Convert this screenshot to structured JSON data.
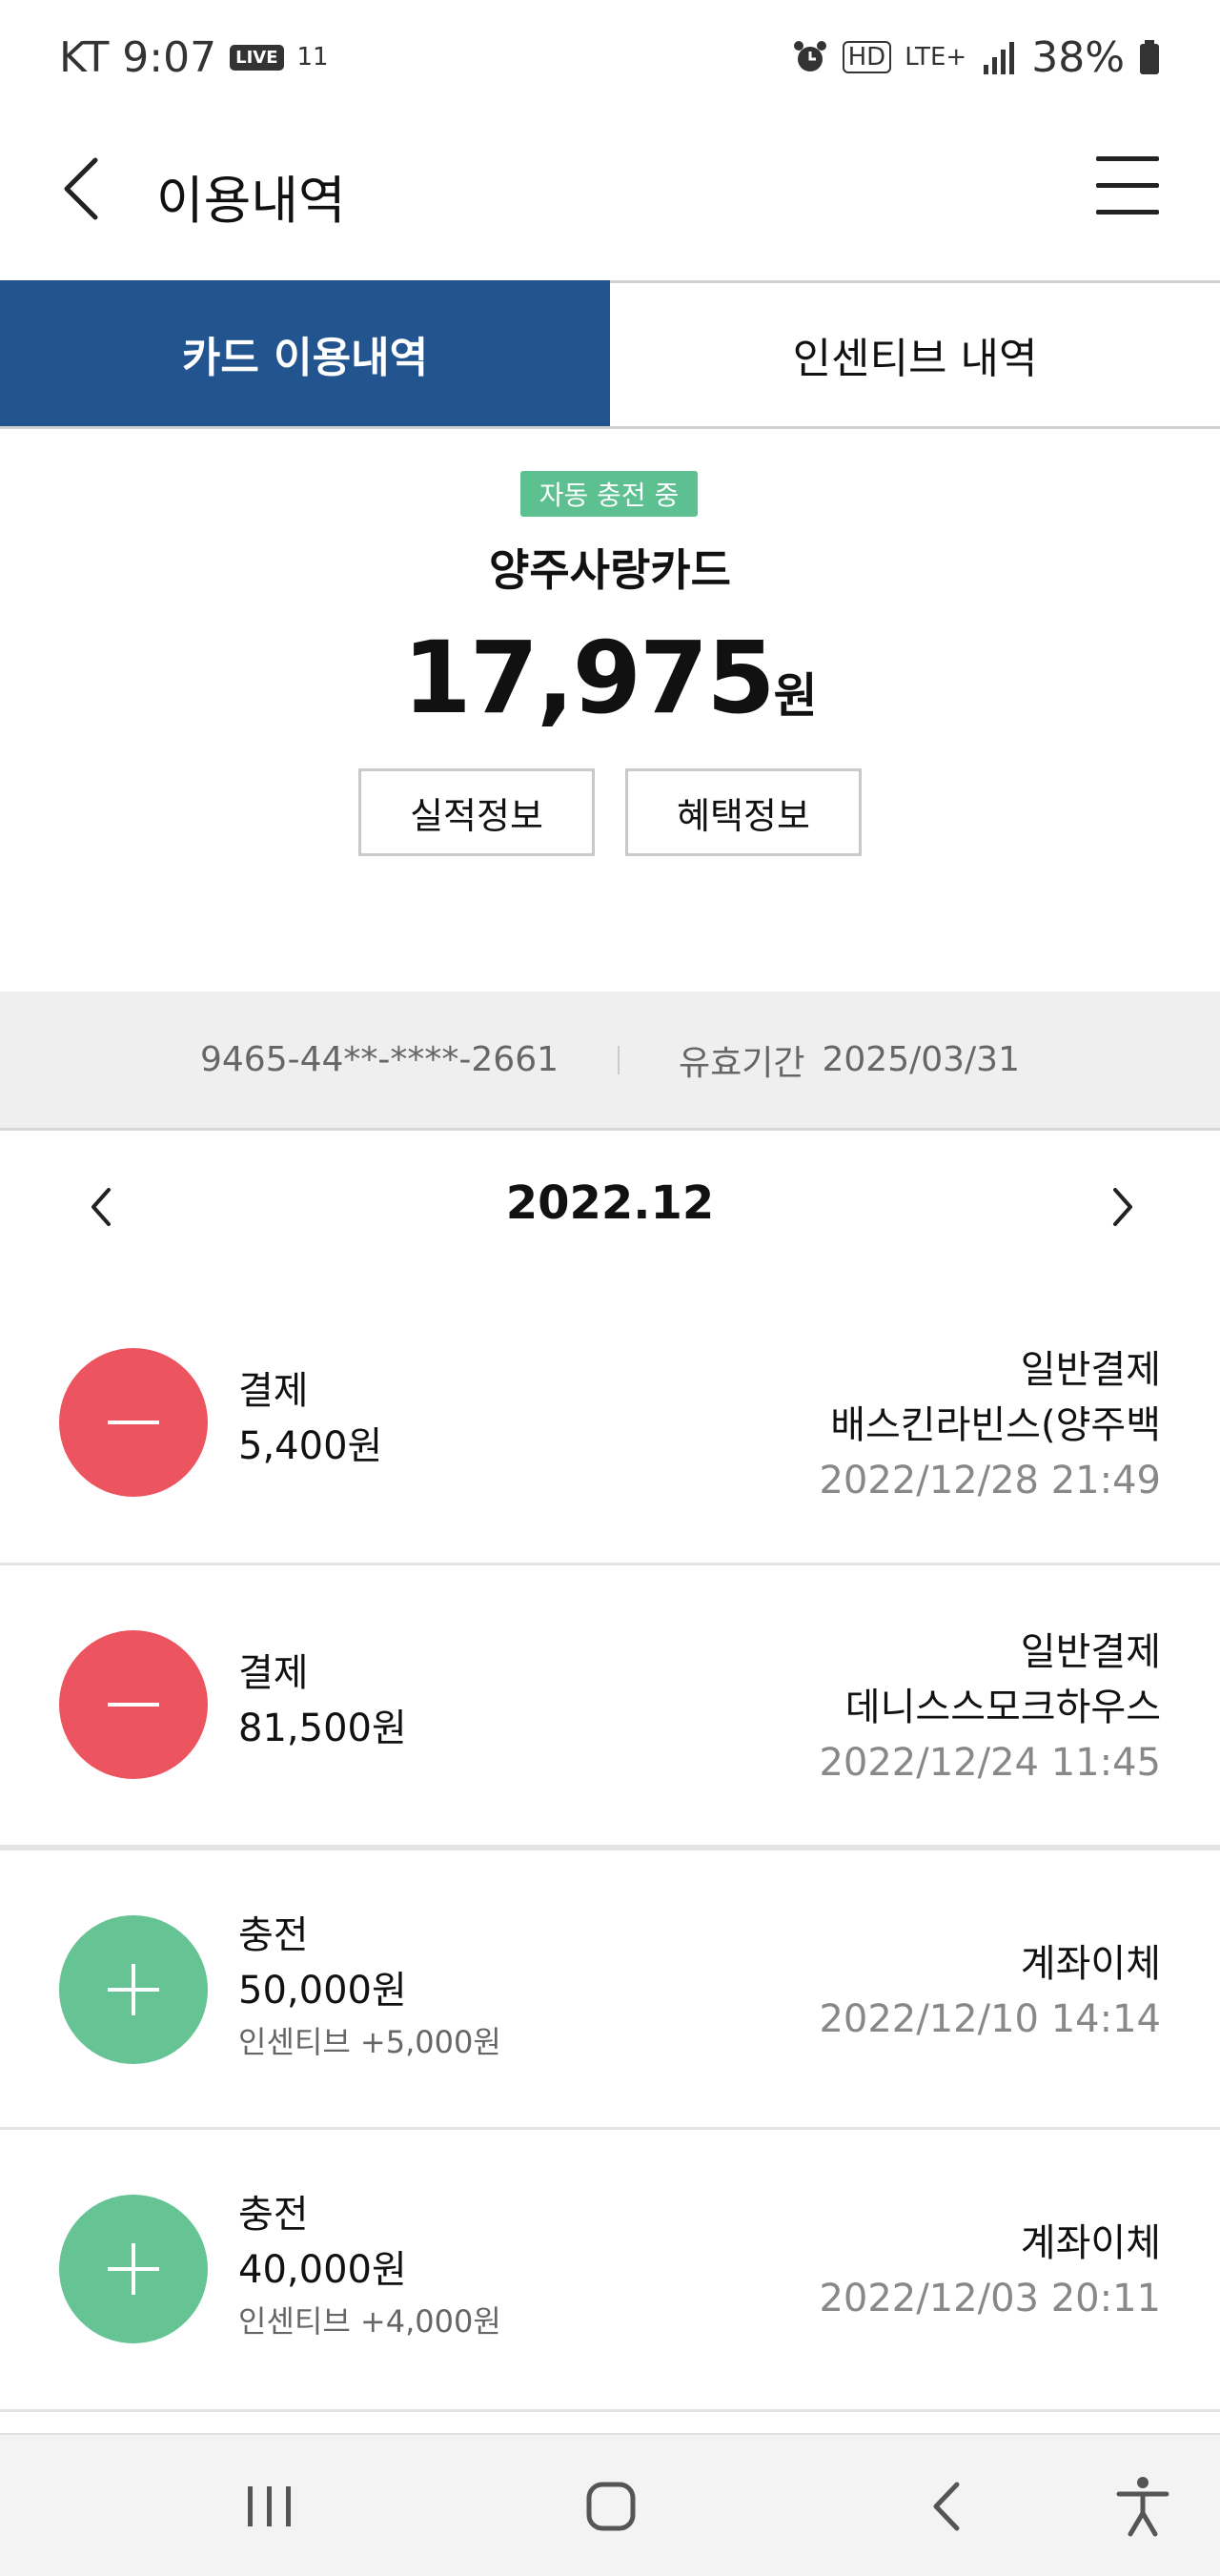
{
  "status_bar": {
    "carrier_time": "KT 9:07",
    "live": "LIVE",
    "st11": "11",
    "hd": "HD",
    "network": "LTE+",
    "battery": "38%"
  },
  "header": {
    "title": "이용내역"
  },
  "tabs": [
    {
      "label": "카드 이용내역",
      "active": true
    },
    {
      "label": "인센티브 내역",
      "active": false
    }
  ],
  "summary": {
    "auto_charge_badge": "자동 충전 중",
    "card_name": "양주사랑카드",
    "balance": "17,975",
    "balance_unit": "원",
    "performance_button": "실적정보",
    "benefit_button": "혜택정보"
  },
  "card_info": {
    "card_number": "9465-44**-****-2661",
    "expiry_label": "유효기간",
    "expiry": "2025/03/31"
  },
  "month_nav": {
    "month": "2022.12"
  },
  "transactions": [
    {
      "type": "결제",
      "amount": "5,400원",
      "method": "일반결제",
      "merchant": "배스킨라빈스(양주백",
      "datetime": "2022/12/28 21:49"
    },
    {
      "type": "결제",
      "amount": "81,500원",
      "method": "일반결제",
      "merchant": "데니스스모크하우스",
      "datetime": "2022/12/24 11:45"
    },
    {
      "type": "충전",
      "amount": "50,000원",
      "incentive": "인센티브 +5,000원",
      "method": "계좌이체",
      "datetime": "2022/12/10 14:14"
    },
    {
      "type": "충전",
      "amount": "40,000원",
      "incentive": "인센티브 +4,000원",
      "method": "계좌이체",
      "datetime": "2022/12/03 20:11"
    }
  ],
  "colors": {
    "tab_active": "#22548f",
    "payment": "#ec5560",
    "charge": "#66c393",
    "badge": "#5cc091"
  }
}
